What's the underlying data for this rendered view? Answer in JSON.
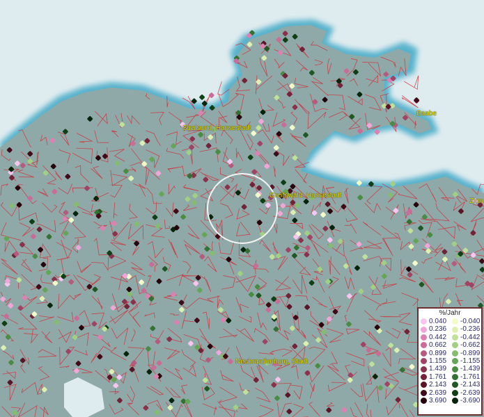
{
  "map": {
    "cities": [
      {
        "name": "Stralsund, Hansestadt"
      },
      {
        "name": "Greifswald, Hansestadt"
      },
      {
        "name": "Baabe"
      },
      {
        "name": "Zinn"
      },
      {
        "name": "Neubrandenburg, Stadt"
      }
    ],
    "colors": {
      "water": "#dfecef",
      "land": "#8fa9a8",
      "shore": "#58b2cc",
      "borders": "#d2313a",
      "label": "#e8e000"
    }
  },
  "legend": {
    "title": "%/Jahr",
    "positive": [
      {
        "label": "0.040",
        "color": "#f7c5ef"
      },
      {
        "label": "0.236",
        "color": "#f0a6d8"
      },
      {
        "label": "0.442",
        "color": "#db82b2"
      },
      {
        "label": "0.662",
        "color": "#c96c97"
      },
      {
        "label": "0.899",
        "color": "#b65a7e"
      },
      {
        "label": "1.155",
        "color": "#a04465"
      },
      {
        "label": "1.439",
        "color": "#8a324c"
      },
      {
        "label": "1.761",
        "color": "#732338"
      },
      {
        "label": "2.143",
        "color": "#5a1526"
      },
      {
        "label": "2.639",
        "color": "#400a16"
      },
      {
        "label": "3.690",
        "color": "#26030a"
      }
    ],
    "negative": [
      {
        "label": "-0.040",
        "color": "#f3fbc9"
      },
      {
        "label": "-0.236",
        "color": "#dcf0b1"
      },
      {
        "label": "-0.442",
        "color": "#bfe199"
      },
      {
        "label": "-0.662",
        "color": "#a1d083"
      },
      {
        "label": "-0.899",
        "color": "#83bd6d"
      },
      {
        "label": "-1.155",
        "color": "#63a656"
      },
      {
        "label": "-1.439",
        "color": "#4a8c43"
      },
      {
        "label": "-1.761",
        "color": "#337233"
      },
      {
        "label": "-2.143",
        "color": "#1f5822"
      },
      {
        "label": "-2.639",
        "color": "#103f15"
      },
      {
        "label": "-3.690",
        "color": "#04250a"
      }
    ]
  }
}
